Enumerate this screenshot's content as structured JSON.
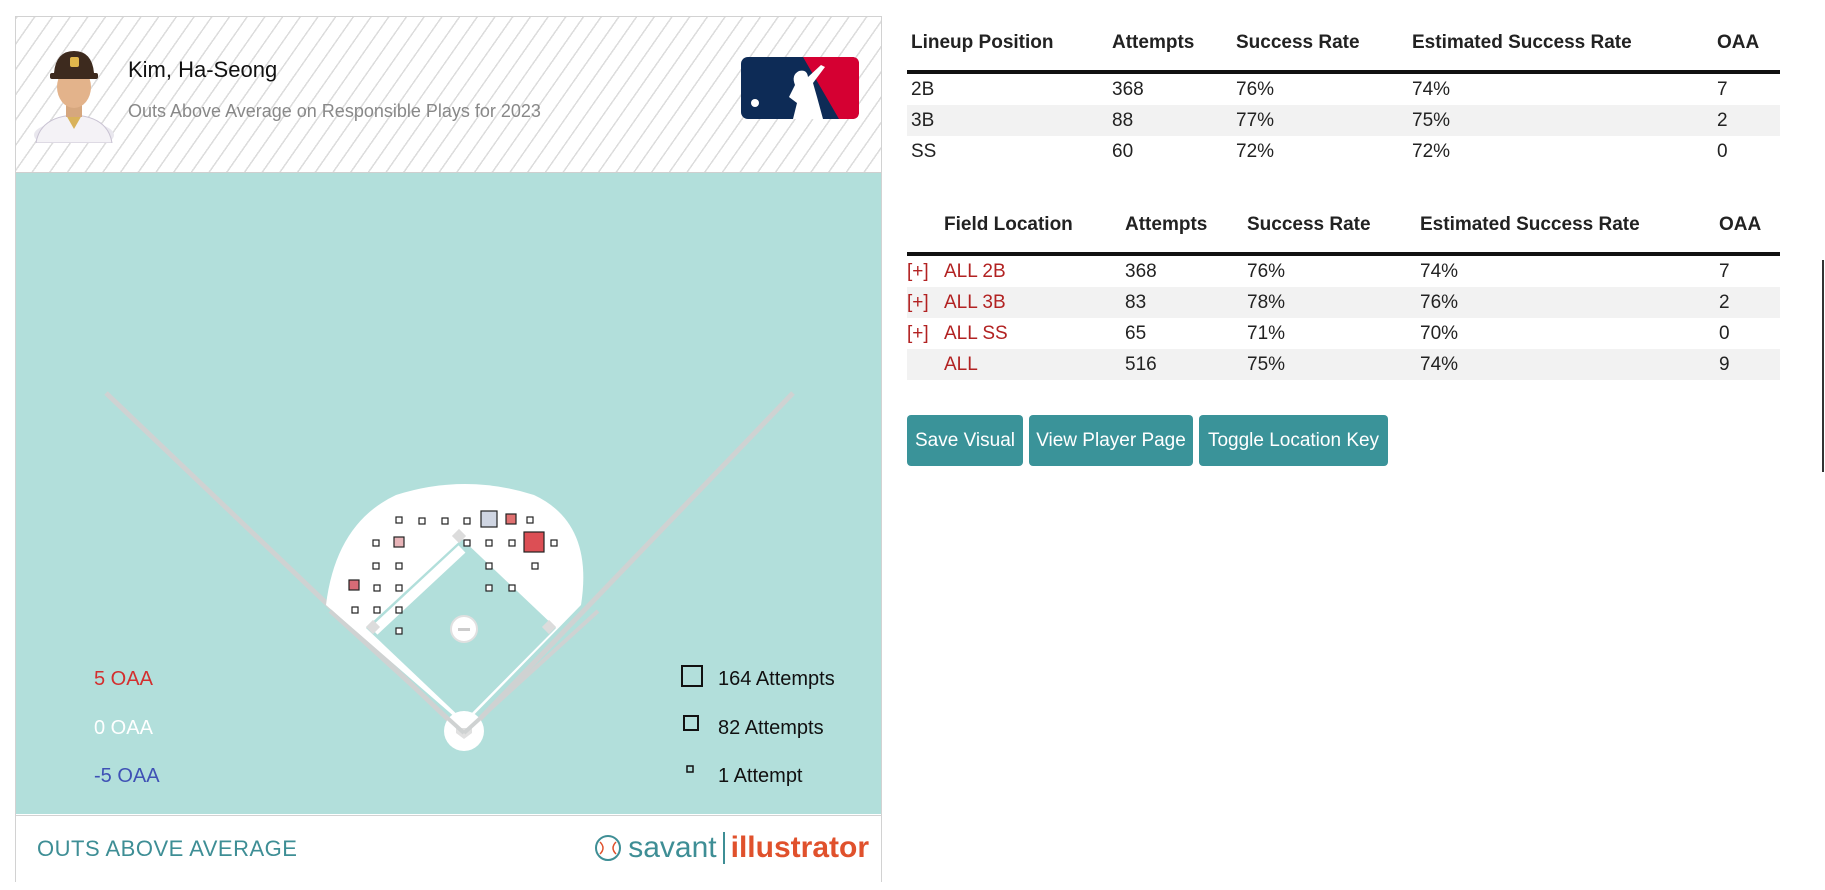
{
  "player": {
    "name": "Kim, Ha-Seong",
    "subtitle": "Outs Above Average on Responsible Plays for 2023"
  },
  "legend": {
    "oaa_high": "5 OAA",
    "oaa_mid": "0 OAA",
    "oaa_low": "-5 OAA",
    "att_large": "164 Attempts",
    "att_medium": "82 Attempts",
    "att_small": "1 Attempt"
  },
  "footer": {
    "title": "OUTS ABOVE AVERAGE",
    "brand_savant": "savant",
    "brand_illustrator": "illustrator"
  },
  "lineup_table": {
    "headers": [
      "Lineup Position",
      "Attempts",
      "Success Rate",
      "Estimated Success Rate",
      "OAA"
    ],
    "rows": [
      [
        "2B",
        "368",
        "76%",
        "74%",
        "7"
      ],
      [
        "3B",
        "88",
        "77%",
        "75%",
        "2"
      ],
      [
        "SS",
        "60",
        "72%",
        "72%",
        "0"
      ]
    ]
  },
  "field_table": {
    "headers": [
      "Field Location",
      "Attempts",
      "Success Rate",
      "Estimated Success Rate",
      "OAA"
    ],
    "rows": [
      {
        "expand": "[+]",
        "location": "ALL 2B",
        "attempts": "368",
        "success": "76%",
        "estimated": "74%",
        "oaa": "7"
      },
      {
        "expand": "[+]",
        "location": "ALL 3B",
        "attempts": "83",
        "success": "78%",
        "estimated": "76%",
        "oaa": "2"
      },
      {
        "expand": "[+]",
        "location": "ALL SS",
        "attempts": "65",
        "success": "71%",
        "estimated": "70%",
        "oaa": "0"
      },
      {
        "expand": "",
        "location": "ALL",
        "attempts": "516",
        "success": "75%",
        "estimated": "74%",
        "oaa": "9"
      }
    ]
  },
  "buttons": {
    "save": "Save Visual",
    "player_page": "View Player Page",
    "toggle_key": "Toggle Location Key"
  },
  "colors": {
    "accent": "#3a9399",
    "field": "#b2dfdb",
    "positive": "#d32f2f",
    "negative": "#3f51b5",
    "link": "#b22222"
  }
}
